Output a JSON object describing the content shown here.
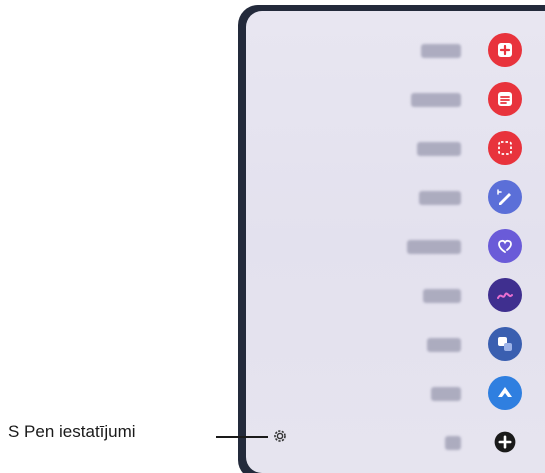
{
  "callout": {
    "label": "S Pen iestatījumi"
  },
  "menu": {
    "items": [
      {
        "name": "create-note",
        "icon": "note-add-icon",
        "color": "#e8333c"
      },
      {
        "name": "view-all-notes",
        "icon": "notes-list-icon",
        "color": "#e8333c"
      },
      {
        "name": "smart-select",
        "icon": "smart-select-icon",
        "color": "#e8333c"
      },
      {
        "name": "screen-write",
        "icon": "screen-write-icon",
        "color": "#5b6fd8"
      },
      {
        "name": "live-messages",
        "icon": "live-message-icon",
        "color": "#6a5bd8"
      },
      {
        "name": "ar-doodle",
        "icon": "doodle-icon",
        "color": "#3f2f8f"
      },
      {
        "name": "translate",
        "icon": "translate-icon",
        "color": "#3a5fb0"
      },
      {
        "name": "bixby-vision",
        "icon": "vision-icon",
        "color": "#2f7fe0"
      },
      {
        "name": "add-shortcut",
        "icon": "add-icon",
        "color": "#1a1a1a"
      }
    ]
  },
  "colors": {
    "panel_bg": "#e5e3ef",
    "frame": "#232a3b"
  }
}
